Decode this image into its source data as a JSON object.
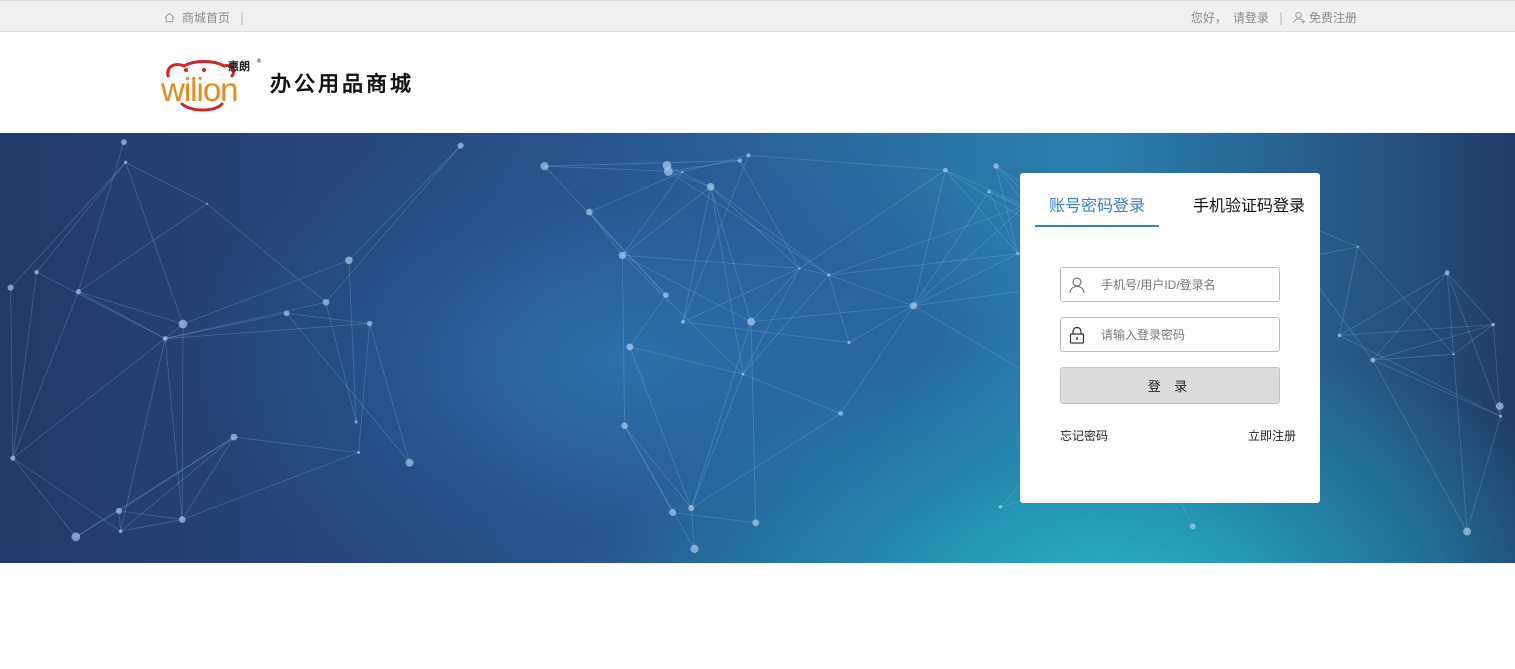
{
  "topbar": {
    "home_label": "商城首页",
    "separator": "|",
    "greeting": "您好，",
    "login_link": "请登录",
    "register_link": "免费注册"
  },
  "header": {
    "logo_cn": "惠朗",
    "logo_en": "wilion",
    "logo_reg": "®",
    "site_title": "办公用品商城"
  },
  "login": {
    "tab_password": "账号密码登录",
    "tab_sms": "手机验证码登录",
    "username_placeholder": "手机号/用户ID/登录名",
    "password_placeholder": "请输入登录密码",
    "submit_label": "登 录",
    "forgot_password": "忘记密码",
    "register_now": "立即注册"
  },
  "colors": {
    "accent": "#3b7fd1",
    "logo_orange": "#e8891e",
    "logo_red": "#d0242b",
    "banner_dark": "#233a6a",
    "banner_teal": "#28bec8"
  },
  "icons": {
    "home": "home-icon",
    "user": "user-icon",
    "username_field": "user-icon",
    "password_field": "lock-icon"
  }
}
